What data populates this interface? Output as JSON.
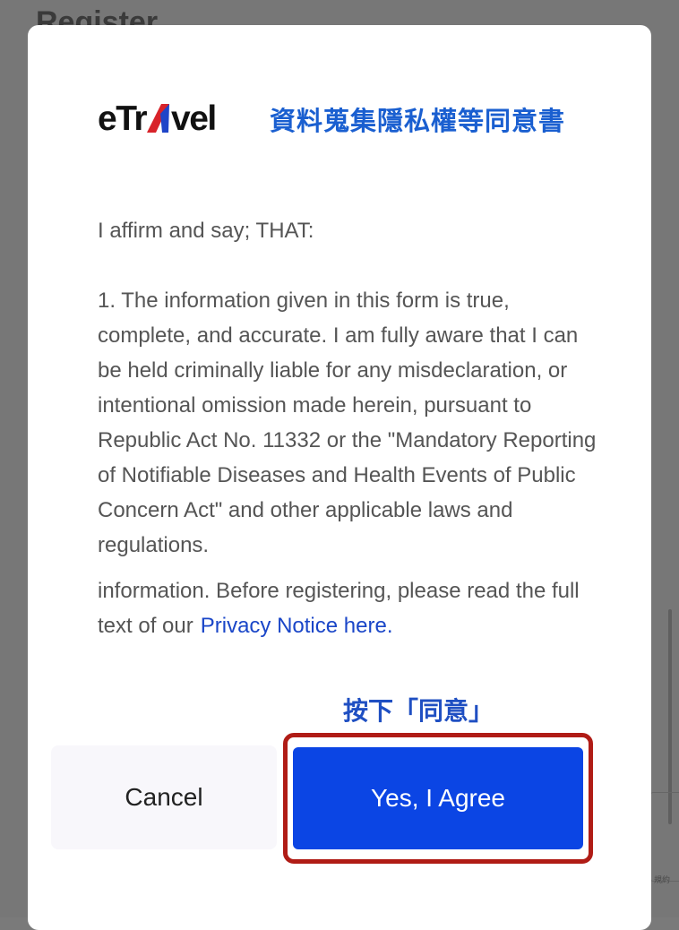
{
  "background": {
    "page_title": "Register",
    "recaptcha_text": "規約"
  },
  "dialog": {
    "logo": {
      "prefix": "eTr",
      "suffix": "vel",
      "brand_colors": {
        "text": "#111111",
        "red": "#d8232a",
        "blue": "#1f45c8"
      }
    },
    "header_title": "資料蒐集隱私權等同意書",
    "intro": "I affirm and say; THAT:",
    "paragraph_1": "1. The information given in this form is true, complete, and accurate. I am fully aware that I can be held criminally liable for any misdeclaration, or intentional omission made herein, pursuant to Republic Act No. 11332 or the \"Mandatory Reporting of Notifiable Diseases and Health Events of Public Concern Act\" and other applicable laws and regulations.",
    "paragraph_2": "information. Before registering, please read the full text of our",
    "privacy_link": "Privacy Notice here.",
    "annotation": "按下「同意」",
    "cancel_label": "Cancel",
    "agree_label": "Yes, I Agree"
  },
  "colors": {
    "primary": "#0b45e4",
    "annotation": "#1f4fc2",
    "highlight_border": "#b01c16",
    "link": "#1a46c8"
  }
}
